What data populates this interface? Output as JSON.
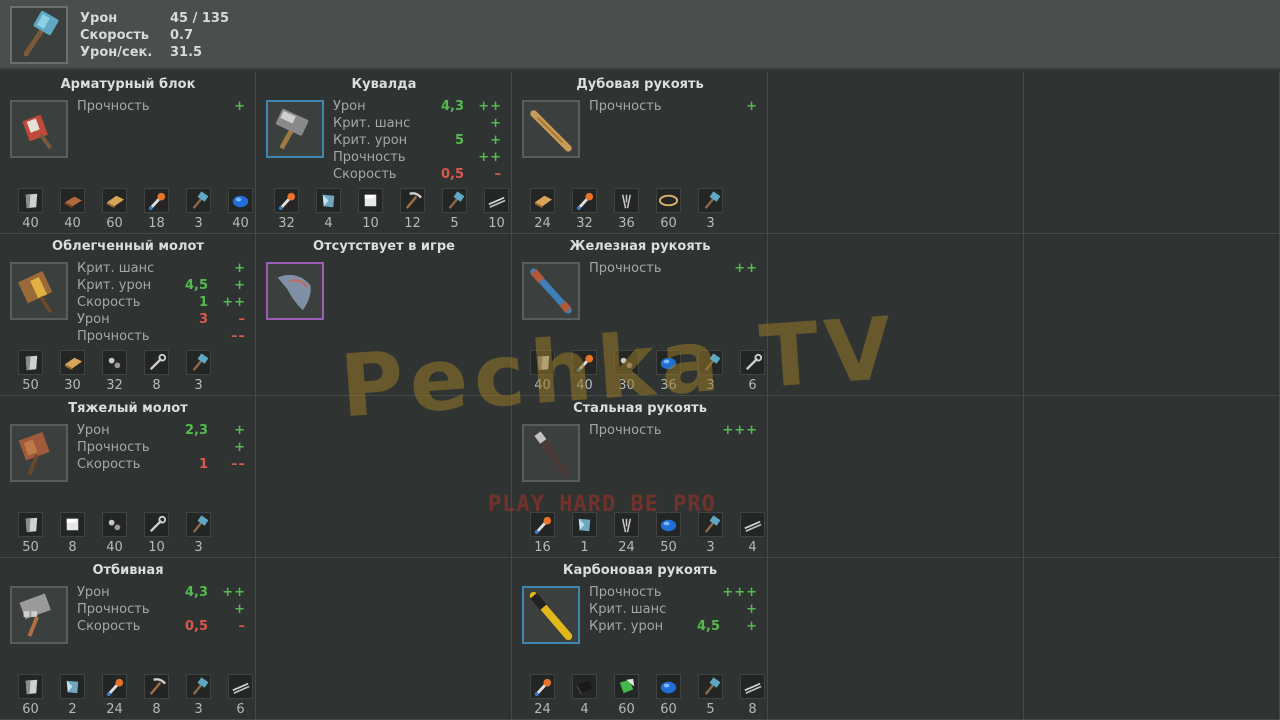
{
  "summary": {
    "stats": [
      {
        "label": "Урон",
        "value": "45 / 135"
      },
      {
        "label": "Скорость",
        "value": "0.7"
      },
      {
        "label": "Урон/сек.",
        "value": "31.5"
      }
    ]
  },
  "cells": [
    {
      "id": "c00",
      "title": "Арматурный блок",
      "slot": "normal",
      "icon": "rebar-block-icon",
      "props": [
        {
          "name": "Прочность",
          "value": "",
          "mark": "+",
          "color": "green"
        }
      ],
      "mats": [
        [
          "metal-scrap-icon",
          "40"
        ],
        [
          "copper-plate-icon",
          "40"
        ],
        [
          "wood-plank-icon",
          "60"
        ],
        [
          "torch-icon",
          "18"
        ],
        [
          "hammer-icon",
          "3"
        ],
        [
          "blue-gem-icon",
          "40"
        ]
      ]
    },
    {
      "id": "c01",
      "title": "Кувалда",
      "slot": "blue",
      "icon": "sledgehammer-head-icon",
      "props": [
        {
          "name": "Урон",
          "value": "4,3",
          "mark": "++",
          "color": "green"
        },
        {
          "name": "Крит. шанс",
          "value": "",
          "mark": "+",
          "color": "green"
        },
        {
          "name": "Крит. урон",
          "value": "5",
          "mark": "+",
          "color": "green"
        },
        {
          "name": "Прочность",
          "value": "",
          "mark": "++",
          "color": "green"
        },
        {
          "name": "Скорость",
          "value": "0,5",
          "mark": "–",
          "color": "red"
        }
      ],
      "mats": [
        [
          "torch-icon",
          "32"
        ],
        [
          "crystal-icon",
          "4"
        ],
        [
          "white-cube-icon",
          "10"
        ],
        [
          "pickaxe-icon",
          "12"
        ],
        [
          "hammer-icon",
          "5"
        ],
        [
          "rods-icon",
          "10"
        ]
      ]
    },
    {
      "id": "c02",
      "title": "Дубовая рукоять",
      "slot": "normal",
      "icon": "oak-handle-icon",
      "props": [
        {
          "name": "Прочность",
          "value": "",
          "mark": "+",
          "color": "green"
        }
      ],
      "mats": [
        [
          "wood-plank-icon",
          "24"
        ],
        [
          "torch-icon",
          "32"
        ],
        [
          "sticks-icon",
          "36"
        ],
        [
          "rope-icon",
          "60"
        ],
        [
          "hammer-icon",
          "3"
        ]
      ]
    },
    {
      "id": "c10",
      "title": "Облегченный молот",
      "slot": "normal",
      "icon": "light-hammer-icon",
      "props": [
        {
          "name": "Крит. шанс",
          "value": "",
          "mark": "+",
          "color": "green"
        },
        {
          "name": "Крит. урон",
          "value": "4,5",
          "mark": "+",
          "color": "green"
        },
        {
          "name": "Скорость",
          "value": "1",
          "mark": "++",
          "color": "green"
        },
        {
          "name": "Урон",
          "value": "3",
          "mark": "–",
          "color": "red"
        },
        {
          "name": "Прочность",
          "value": "",
          "mark": "––",
          "color": "red"
        }
      ],
      "mats": [
        [
          "metal-scrap-icon",
          "50"
        ],
        [
          "wood-plank-icon",
          "30"
        ],
        [
          "bolts-icon",
          "32"
        ],
        [
          "wrench-icon",
          "8"
        ],
        [
          "hammer-icon",
          "3"
        ]
      ]
    },
    {
      "id": "c11",
      "title": "Отсутствует в игре",
      "slot": "purple",
      "icon": "unknown-part-icon",
      "props": [],
      "mats": []
    },
    {
      "id": "c12",
      "title": "Железная рукоять",
      "slot": "normal",
      "icon": "iron-handle-icon",
      "props": [
        {
          "name": "Прочность",
          "value": "",
          "mark": "++",
          "color": "green"
        }
      ],
      "mats": [
        [
          "metal-scrap-icon",
          "40"
        ],
        [
          "torch-icon",
          "40"
        ],
        [
          "bolts-icon",
          "30"
        ],
        [
          "blue-gem-icon",
          "36"
        ],
        [
          "hammer-icon",
          "3"
        ],
        [
          "wrench-icon",
          "6"
        ]
      ]
    },
    {
      "id": "c20",
      "title": "Тяжелый молот",
      "slot": "normal",
      "icon": "heavy-hammer-icon",
      "props": [
        {
          "name": "Урон",
          "value": "2,3",
          "mark": "+",
          "color": "green"
        },
        {
          "name": "Прочность",
          "value": "",
          "mark": "+",
          "color": "green"
        },
        {
          "name": "Скорость",
          "value": "1",
          "mark": "––",
          "color": "red"
        }
      ],
      "mats": [
        [
          "metal-scrap-icon",
          "50"
        ],
        [
          "white-cube-icon",
          "8"
        ],
        [
          "bolts-icon",
          "40"
        ],
        [
          "wrench-icon",
          "10"
        ],
        [
          "hammer-icon",
          "3"
        ]
      ]
    },
    {
      "id": "c22",
      "title": "Стальная рукоять",
      "slot": "normal",
      "icon": "steel-handle-icon",
      "props": [
        {
          "name": "Прочность",
          "value": "",
          "mark": "+++",
          "color": "green"
        }
      ],
      "mats": [
        [
          "torch-icon",
          "16"
        ],
        [
          "crystal-icon",
          "1"
        ],
        [
          "sticks-icon",
          "24"
        ],
        [
          "blue-gem-icon",
          "50"
        ],
        [
          "hammer-icon",
          "3"
        ],
        [
          "rods-icon",
          "4"
        ]
      ]
    },
    {
      "id": "c30",
      "title": "Отбивная",
      "slot": "normal",
      "icon": "meat-tenderizer-icon",
      "props": [
        {
          "name": "Урон",
          "value": "4,3",
          "mark": "++",
          "color": "green"
        },
        {
          "name": "Прочность",
          "value": "",
          "mark": "+",
          "color": "green"
        },
        {
          "name": "Скорость",
          "value": "0,5",
          "mark": "–",
          "color": "red"
        }
      ],
      "mats": [
        [
          "metal-scrap-icon",
          "60"
        ],
        [
          "crystal-icon",
          "2"
        ],
        [
          "torch-icon",
          "24"
        ],
        [
          "pickaxe-icon",
          "8"
        ],
        [
          "hammer-icon",
          "3"
        ],
        [
          "rods-icon",
          "6"
        ]
      ]
    },
    {
      "id": "c32",
      "title": "Карбоновая рукоять",
      "slot": "blue",
      "icon": "carbon-handle-icon",
      "props": [
        {
          "name": "Прочность",
          "value": "",
          "mark": "+++",
          "color": "green"
        },
        {
          "name": "Крит. шанс",
          "value": "",
          "mark": "+",
          "color": "green"
        },
        {
          "name": "Крит. урон",
          "value": "4,5",
          "mark": "+",
          "color": "green"
        }
      ],
      "mats": [
        [
          "torch-icon",
          "24"
        ],
        [
          "carbon-plate-icon",
          "4"
        ],
        [
          "green-chip-icon",
          "60"
        ],
        [
          "blue-gem-icon",
          "60"
        ],
        [
          "hammer-icon",
          "5"
        ],
        [
          "rods-icon",
          "8"
        ]
      ]
    }
  ],
  "watermark": {
    "main": "Pechka TV",
    "sub": "PLAY HARD  BE PRO"
  }
}
